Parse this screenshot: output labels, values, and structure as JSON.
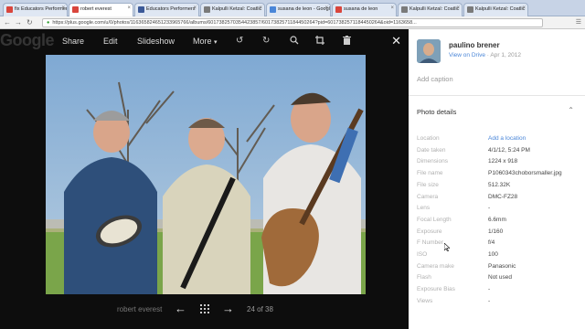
{
  "browser": {
    "tabs": [
      {
        "label": "fix Educators Performers",
        "color": "#d9453c",
        "active": false
      },
      {
        "label": "robert everest",
        "color": "#d9453c",
        "active": true
      },
      {
        "label": "Educators Performers",
        "color": "#3b5998",
        "active": false
      },
      {
        "label": "Kalpulli Ketzal: Coatlic",
        "color": "#7a7a7a",
        "active": false
      },
      {
        "label": "susana de leon - Googl",
        "color": "#4a86d8",
        "active": false
      },
      {
        "label": "susana de leon",
        "color": "#d9453c",
        "active": false
      },
      {
        "label": "Kalpulli Ketzal: Coatlic",
        "color": "#7a7a7a",
        "active": false
      },
      {
        "label": "Kalpulli Ketzal: Coatlic",
        "color": "#7a7a7a",
        "active": false
      }
    ],
    "url_host": "https://plus.google.com",
    "url_path": "/u/0/photos/116365824651233965766/albums/6017382570354423857/6017382571184450264?pid=6017382571184450264&oid=1163658..."
  },
  "viewer": {
    "logo": "Google",
    "toolbar": {
      "share": "Share",
      "edit": "Edit",
      "slideshow": "Slideshow",
      "more": "More"
    },
    "owner": "robert everest",
    "counter": "24 of 38"
  },
  "panel": {
    "owner_name": "paulino brener",
    "view_on_drive": "View on Drive",
    "date_sep": " · ",
    "date": "Apr 1, 2012",
    "add_caption": "Add caption",
    "details_title": "Photo details",
    "details": [
      {
        "key": "Location",
        "value": "Add a location",
        "link": true
      },
      {
        "key": "Date taken",
        "value": "4/1/12, 5:24 PM",
        "link": false
      },
      {
        "key": "Dimensions",
        "value": "1224 x 918",
        "link": false
      },
      {
        "key": "File name",
        "value": "P1060343choborsmaller.jpg",
        "link": false
      },
      {
        "key": "File size",
        "value": "512.32K",
        "link": false
      },
      {
        "key": "Camera",
        "value": "DMC-FZ28",
        "link": false
      },
      {
        "key": "Lens",
        "value": "-",
        "link": false
      },
      {
        "key": "Focal Length",
        "value": "6.6mm",
        "link": false
      },
      {
        "key": "Exposure",
        "value": "1/160",
        "link": false
      },
      {
        "key": "F Number",
        "value": "f/4",
        "link": false
      },
      {
        "key": "ISO",
        "value": "100",
        "link": false
      },
      {
        "key": "Camera make",
        "value": "Panasonic",
        "link": false
      },
      {
        "key": "Flash",
        "value": "Not used",
        "link": false
      },
      {
        "key": "Exposure Bias",
        "value": "-",
        "link": false
      },
      {
        "key": "Views",
        "value": "-",
        "link": false
      }
    ]
  },
  "colors": {
    "link": "#4a86d8",
    "viewer_bg": "#0d0d0d",
    "panel_bg": "#ffffff"
  },
  "icons": [
    "rotate-left-icon",
    "rotate-right-icon",
    "zoom-icon",
    "crop-icon",
    "trash-icon",
    "close-icon",
    "grid-icon",
    "arrow-left-icon",
    "arrow-right-icon",
    "chevron-up-icon"
  ]
}
